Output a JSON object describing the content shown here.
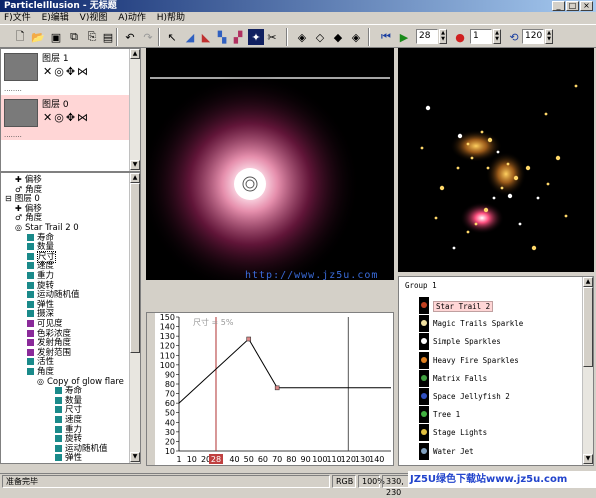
{
  "window": {
    "title": "ParticleIllusion - 无标题",
    "min_label": "_",
    "max_label": "□",
    "close_label": "×"
  },
  "menu": [
    "F)文件",
    "E)编辑",
    "V)视图",
    "A)动作",
    "H)帮助"
  ],
  "toolbar": {
    "frame_value": "28",
    "record_value": "1",
    "loop_value": "120"
  },
  "layers": [
    {
      "name": "图层 1",
      "dots": "........"
    },
    {
      "name": "图层 0",
      "dots": "........"
    }
  ],
  "tree": {
    "items": [
      {
        "label": "偏移",
        "indent": 14,
        "icon": "+"
      },
      {
        "label": "角度",
        "indent": 14,
        "icon": "~"
      },
      {
        "label": "图层 0",
        "indent": 4,
        "icon": "-"
      },
      {
        "label": "偏移",
        "indent": 14,
        "icon": "+"
      },
      {
        "label": "角度",
        "indent": 14,
        "icon": "~"
      },
      {
        "label": "Star Trail 2 0",
        "indent": 14,
        "icon": "o"
      },
      {
        "label": "寿命",
        "indent": 26,
        "icon": "teal"
      },
      {
        "label": "数量",
        "indent": 26,
        "icon": "teal"
      },
      {
        "label": "尺寸",
        "indent": 26,
        "icon": "teal",
        "selected": true
      },
      {
        "label": "速度",
        "indent": 26,
        "icon": "teal"
      },
      {
        "label": "重力",
        "indent": 26,
        "icon": "teal"
      },
      {
        "label": "旋转",
        "indent": 26,
        "icon": "teal"
      },
      {
        "label": "运动随机值",
        "indent": 26,
        "icon": "teal"
      },
      {
        "label": "弹性",
        "indent": 26,
        "icon": "teal"
      },
      {
        "label": "摄深",
        "indent": 26,
        "icon": "teal"
      },
      {
        "label": "可见度",
        "indent": 26,
        "icon": "purple"
      },
      {
        "label": "色彩浓度",
        "indent": 26,
        "icon": "purple"
      },
      {
        "label": "发射角度",
        "indent": 26,
        "icon": "purple"
      },
      {
        "label": "发射范围",
        "indent": 26,
        "icon": "purple"
      },
      {
        "label": "活性",
        "indent": 26,
        "icon": "teal"
      },
      {
        "label": "角度",
        "indent": 26,
        "icon": "teal"
      },
      {
        "label": "Copy of glow flare",
        "indent": 36,
        "icon": "o"
      },
      {
        "label": "寿命",
        "indent": 54,
        "icon": "teal"
      },
      {
        "label": "数量",
        "indent": 54,
        "icon": "teal"
      },
      {
        "label": "尺寸",
        "indent": 54,
        "icon": "teal"
      },
      {
        "label": "速度",
        "indent": 54,
        "icon": "teal"
      },
      {
        "label": "重力",
        "indent": 54,
        "icon": "teal"
      },
      {
        "label": "旋转",
        "indent": 54,
        "icon": "teal"
      },
      {
        "label": "运动随机值",
        "indent": 54,
        "icon": "teal"
      },
      {
        "label": "弹性",
        "indent": 54,
        "icon": "teal"
      }
    ]
  },
  "graph": {
    "label": "尺寸 = 5%",
    "y_ticks": [
      "150",
      "140",
      "130",
      "120",
      "110",
      "100",
      "90",
      "80",
      "70",
      "60",
      "50",
      "40",
      "30",
      "20",
      "10"
    ],
    "x_ticks": [
      "1",
      "10",
      "20",
      "28",
      "40",
      "50",
      "60",
      "70",
      "80",
      "90",
      "100",
      "110",
      "120",
      "130",
      "140"
    ],
    "current_frame": "28",
    "points": [
      {
        "frame": 1,
        "value": 60
      },
      {
        "frame": 50,
        "value": 127
      },
      {
        "frame": 70,
        "value": 76
      },
      {
        "frame": 150,
        "value": 76
      }
    ]
  },
  "emitters": {
    "group": "Group 1",
    "items": [
      {
        "label": "Star Trail 2",
        "selected": true
      },
      {
        "label": "Magic Trails Sparkle"
      },
      {
        "label": "Simple Sparkles"
      },
      {
        "label": "Heavy Fire Sparkles"
      },
      {
        "label": "Matrix Falls"
      },
      {
        "label": "Space Jellyfish 2"
      },
      {
        "label": "Tree 1"
      },
      {
        "label": "Stage Lights"
      },
      {
        "label": "Water Jet"
      }
    ]
  },
  "status": {
    "text": "准备完毕",
    "mode": "RGB",
    "zoom": "100%",
    "coords": "330, 230"
  },
  "watermarks": {
    "center": "http://www.jz5u.com",
    "bottom": "JZ5U绿色下载站www.jz5u.com"
  },
  "colors": {
    "title_bar": "#0a246a",
    "panel_bg": "#d4d0c8",
    "selected_layer": "#ffd6d6",
    "curve": "#000000",
    "frame_marker": "#b03030"
  }
}
